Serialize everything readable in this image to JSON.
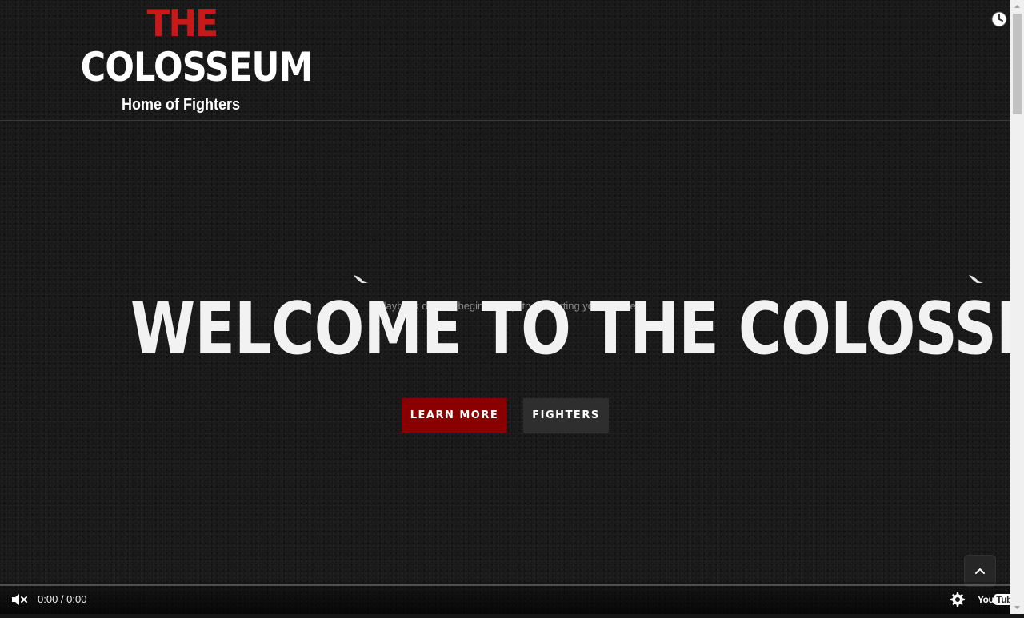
{
  "header": {
    "logo_the": "THE",
    "logo_name": "COLOSSEUM",
    "logo_tagline": "Home of Fighters",
    "history_icon": "clock-icon"
  },
  "hero": {
    "title": "WELCOME TO THE COLOSSEUM",
    "overlay_text": "If playback doesn't begin shortly, try restarting your device.",
    "learn_more_label": "LEARN MORE",
    "fighters_label": "FIGHTERS"
  },
  "video": {
    "time": "0:00 / 0:00",
    "progress": 0,
    "mute_icon": "muted-speaker-icon",
    "settings_icon": "gear-icon",
    "logo_you": "You",
    "logo_tube": "Tube"
  },
  "colors": {
    "brand_red": "#c61a1a",
    "learn_more_bg": "#8a0000",
    "fighters_bg": "#2e2e2e",
    "background": "#171717"
  }
}
